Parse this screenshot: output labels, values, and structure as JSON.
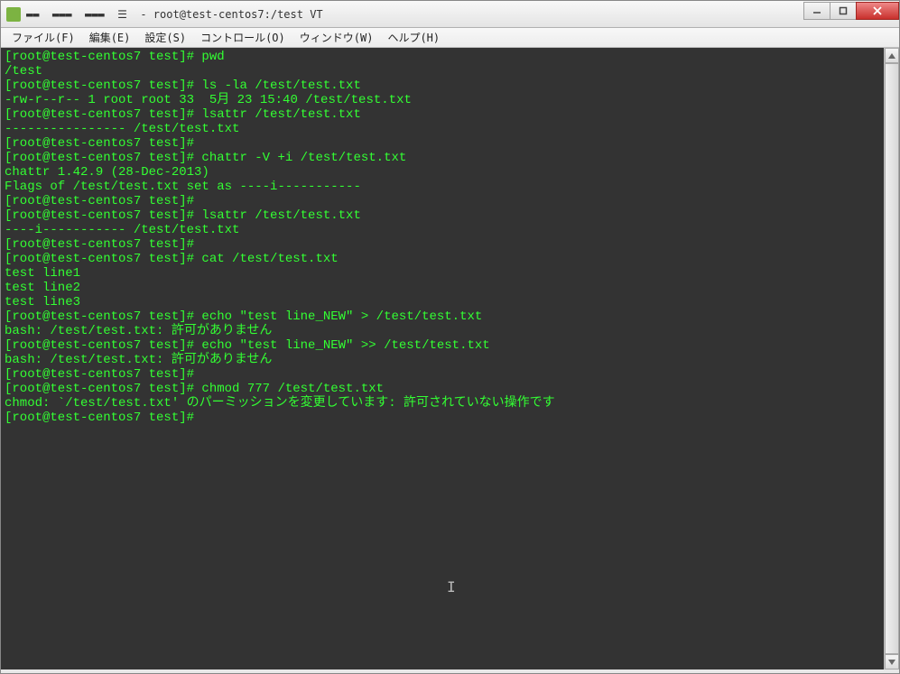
{
  "window": {
    "title": "▬▬  ▬▬▬  ▬▬▬  ☰  - root@test-centos7:/test VT"
  },
  "menu": {
    "file": "ファイル(F)",
    "edit": "編集(E)",
    "setup": "設定(S)",
    "control": "コントロール(O)",
    "window": "ウィンドウ(W)",
    "help": "ヘルプ(H)"
  },
  "terminal": {
    "lines": [
      "[root@test-centos7 test]# pwd",
      "/test",
      "[root@test-centos7 test]# ls -la /test/test.txt",
      "-rw-r--r-- 1 root root 33  5月 23 15:40 /test/test.txt",
      "[root@test-centos7 test]# lsattr /test/test.txt",
      "---------------- /test/test.txt",
      "[root@test-centos7 test]#",
      "[root@test-centos7 test]# chattr -V +i /test/test.txt",
      "chattr 1.42.9 (28-Dec-2013)",
      "Flags of /test/test.txt set as ----i-----------",
      "[root@test-centos7 test]#",
      "[root@test-centos7 test]# lsattr /test/test.txt",
      "----i----------- /test/test.txt",
      "[root@test-centos7 test]#",
      "[root@test-centos7 test]# cat /test/test.txt",
      "test line1",
      "test line2",
      "test line3",
      "[root@test-centos7 test]# echo \"test line_NEW\" > /test/test.txt",
      "bash: /test/test.txt: 許可がありません",
      "[root@test-centos7 test]# echo \"test line_NEW\" >> /test/test.txt",
      "bash: /test/test.txt: 許可がありません",
      "[root@test-centos7 test]#",
      "[root@test-centos7 test]# chmod 777 /test/test.txt",
      "chmod: `/test/test.txt' のパーミッションを変更しています: 許可されていない操作です",
      "[root@test-centos7 test]#"
    ]
  },
  "colors": {
    "terminal_bg": "#333333",
    "terminal_fg": "#33ff33"
  }
}
